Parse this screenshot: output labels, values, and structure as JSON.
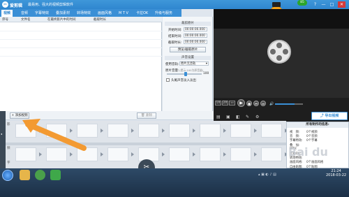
{
  "title_bar": {
    "app_name": "爱剪辑",
    "slogan": "最易用、强大的视频剪辑软件",
    "notification_badge": "85",
    "buttons": [
      "?",
      "—",
      "□",
      "✕"
    ]
  },
  "tabs": [
    "视频",
    "音频",
    "字幕特效",
    "叠加素材",
    "转场特效",
    "画面风格",
    "M T V",
    "卡拉OK",
    "升级与服务"
  ],
  "video_list": {
    "columns": [
      "序号",
      "文件名",
      "在最终影片中的时间",
      "截取时长"
    ]
  },
  "side_panel": {
    "clip_section_title": "裁剪原片",
    "start_time_label": "开始时间:",
    "start_time_value": "00:00:00.000",
    "end_time_label": "结束时间:",
    "end_time_value": "00:00:00.000",
    "duration_label": "截取时长:",
    "duration_value": "00:00:00.000",
    "preview_button": "预览/截取原片",
    "audio_section_title": "声音设置",
    "audio_track_label": "使用音轨:",
    "audio_track_value": "原片无音轨",
    "volume_label": "原片音量:",
    "volume_hint": "(提示:100为原音量)",
    "volume_value": "100",
    "fade_checkbox_label": "头尾声音淡入淡出",
    "confirm_button": "确认修改"
  },
  "bottom_toolbar": {
    "add_video_button": "添加视频",
    "delete_button": "删除"
  },
  "controls": {
    "speed_1x": "1X",
    "speed_2x": "2X",
    "fullscreen_label": "▭",
    "export_button": "导出视频"
  },
  "timeline": {
    "track_labels": [
      "影",
      "频",
      "字"
    ]
  },
  "info_panel": {
    "title": "所有制作的信息:",
    "rows": [
      {
        "label": "视　频:",
        "value": "0个视频"
      },
      {
        "label": "音　频:",
        "value": "0个音频"
      },
      {
        "label": "字幕特效:",
        "value": "0个字幕"
      },
      {
        "label": "叠　加:",
        "value": ""
      },
      {
        "label": "MTV:",
        "value": ""
      },
      {
        "label": "卡拉OK:",
        "value": ""
      },
      {
        "label": "转场特效:",
        "value": ""
      },
      {
        "label": "画面风格:",
        "value": "0个画面风格"
      },
      {
        "label": "自由贴图:",
        "value": "0个贴图"
      }
    ]
  },
  "taskbar": {
    "time": "21:24",
    "date": "2018-03-22"
  },
  "watermark": "Bai du"
}
